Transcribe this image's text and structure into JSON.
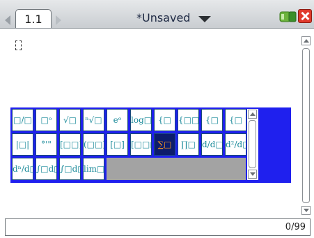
{
  "titlebar": {
    "tab_label": "1.1",
    "document_title": "*Unsaved"
  },
  "icons": {
    "nav_prev": "triangle-left-icon",
    "nav_next": "triangle-right-icon",
    "menu": "caret-down-icon",
    "battery": "battery-icon",
    "close": "close-x-icon"
  },
  "palette": {
    "rows": [
      [
        "□/□",
        "□ᵒ",
        "√□",
        "ⁿ√□",
        "eᵒ",
        "log□",
        "{□",
        "{□□",
        "{□",
        "{□"
      ],
      [
        "|□|",
        "°'\"",
        "[□□]",
        "(□□)",
        "[□]",
        "[□□□]",
        "∑□",
        "∏□",
        "d/d□",
        "d²/d□"
      ],
      [
        "dⁿ/d□",
        "∫□d□",
        "∫□d□",
        "lim□"
      ]
    ],
    "selected": "∑□"
  },
  "status": {
    "char_count": "0/99"
  },
  "colors": {
    "palette_bg": "#1f20ee",
    "selected_cell": "#0c1c6b",
    "symbol_color": "#1a8a9a",
    "selected_symbol": "#ff9a1f",
    "close_button": "#e03a2c"
  }
}
